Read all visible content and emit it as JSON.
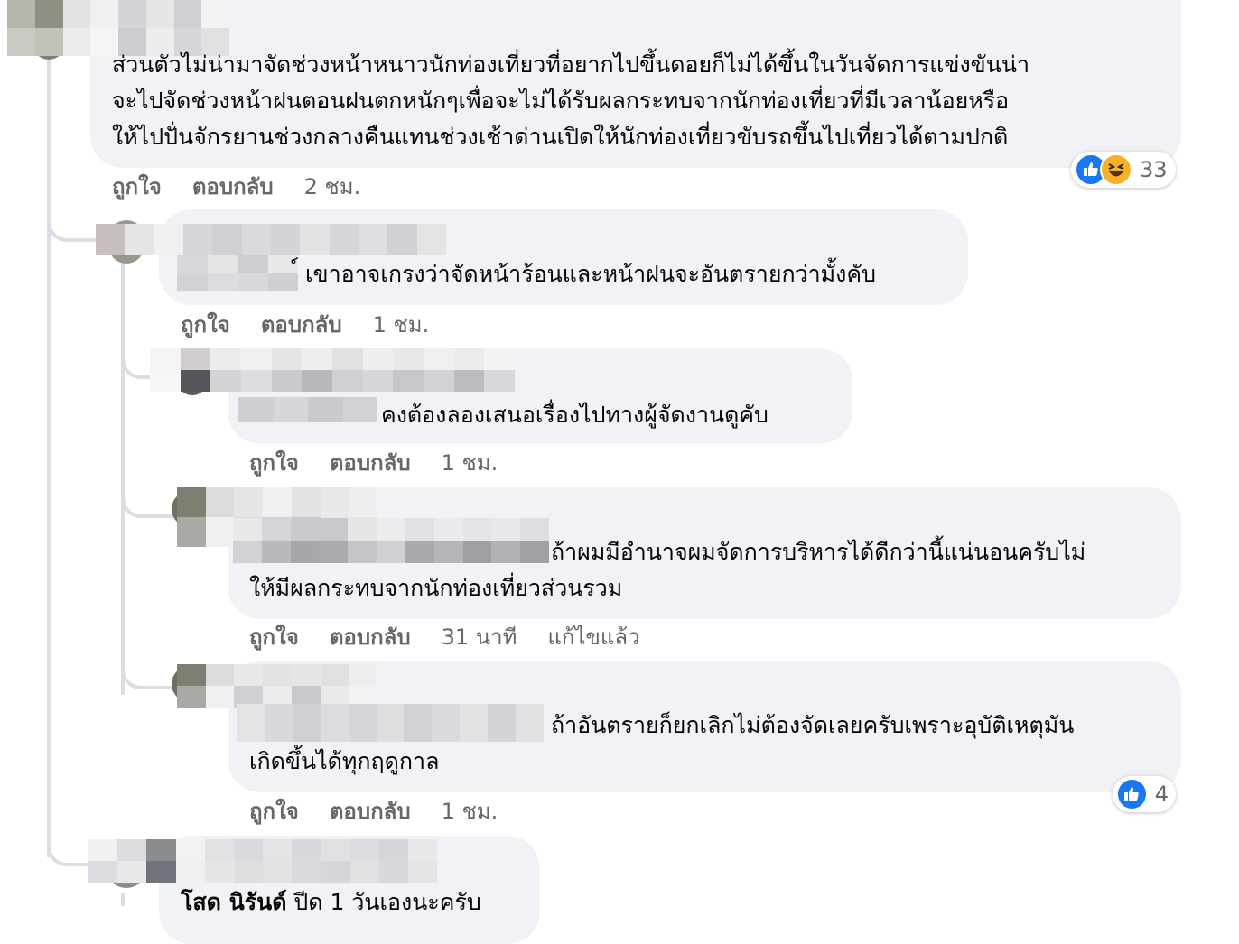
{
  "comments": [
    {
      "text_lines": [
        "ส่วนตัวไม่น่ามาจัดช่วงหน้าหนาวนักท่องเที่ยวที่อยากไปขึ้นดอยก็ไม่ได้ขึ้นในวันจัดการแข่งขันน่า",
        "จะไปจัดช่วงหน้าฝนตอนฝนตกหนักๆเพื่อจะไม่ได้รับผลกระทบจากนักท่องเที่ยวที่มีเวลาน้อยหรือ",
        "ให้ไปปั่นจักรยานช่วงกลางคืนแทนช่วงเช้าด่านเปิดให้นักท่องเที่ยวขับรถขึ้นไปเที่ยวได้ตามปกติ"
      ],
      "like_label": "ถูกใจ",
      "reply_label": "ตอบกลับ",
      "time": "2 ชม.",
      "reaction_count": "33"
    },
    {
      "text_lines": [
        "์ เขาอาจเกรงว่าจัดหน้าร้อนและหน้าฝนจะอันตรายกว่ามั้งคับ"
      ],
      "like_label": "ถูกใจ",
      "reply_label": "ตอบกลับ",
      "time": "1 ชม."
    },
    {
      "text_lines": [
        "คงต้องลองเสนอเรื่องไปทางผู้จัดงานดูคับ"
      ],
      "like_label": "ถูกใจ",
      "reply_label": "ตอบกลับ",
      "time": "1 ชม."
    },
    {
      "text_lines": [
        "ถ้าผมมีอำนาจผมจัดการบริหารได้ดีกว่านี้แน่นอนครับไม่",
        "ให้มีผลกระทบจากนักท่องเที่ยวส่วนรวม"
      ],
      "like_label": "ถูกใจ",
      "reply_label": "ตอบกลับ",
      "time": "31 นาที",
      "edited": "แก้ไขแล้ว"
    },
    {
      "text_lines": [
        "ถ้าอันตรายก็ยกเลิกไม่ต้องจัดเลยครับเพราะอุบัติเหตุมัน",
        "เกิดขึ้นได้ทุกฤดูกาล"
      ],
      "like_label": "ถูกใจ",
      "reply_label": "ตอบกลับ",
      "time": "1 ชม.",
      "reaction_count": "4"
    },
    {
      "author": "โสด นิรันด์",
      "text_lines": [
        "ปีด 1 วันเองนะครับ"
      ]
    }
  ],
  "colors": {
    "bubble": "#f0f2f5",
    "text": "#050505",
    "meta": "#65676b",
    "like_blue": "#1877f2",
    "haha_yellow": "#f7b125",
    "thread_line": "#dadde1"
  },
  "icons": [
    "like-reaction-icon",
    "haha-reaction-icon"
  ]
}
